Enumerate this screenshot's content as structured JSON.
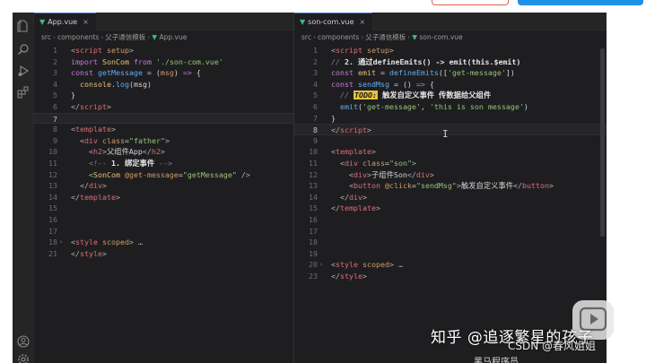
{
  "left_editor": {
    "tab_label": "App.vue",
    "breadcrumb": [
      "src",
      "components",
      "父子通信模板",
      "App.vue"
    ],
    "lines": [
      {
        "n": "1",
        "html": "<span class=\"t-pun\">&lt;</span><span class=\"t-tag\">script</span> <span class=\"t-attr\">setup</span><span class=\"t-pun\">&gt;</span>"
      },
      {
        "n": "2",
        "html": "<span class=\"t-kw\">import</span> <span class=\"t-var\">SonCom</span> <span class=\"t-kw\">from</span> <span class=\"t-str\">'./son-com.vue'</span>"
      },
      {
        "n": "3",
        "html": "<span class=\"t-kw\">const</span> <span class=\"t-fn\">getMessage</span> = (<span class=\"t-attr\">msg</span>) <span class=\"t-kw\">=&gt;</span> {"
      },
      {
        "n": "4",
        "html": "  <span class=\"t-var\">console</span>.<span class=\"t-fn\">log</span>(msg)"
      },
      {
        "n": "5",
        "html": "}"
      },
      {
        "n": "6",
        "html": "<span class=\"t-pun\">&lt;/</span><span class=\"t-tag\">script</span><span class=\"t-pun\">&gt;</span>"
      },
      {
        "n": "7",
        "html": "",
        "current": true
      },
      {
        "n": "8",
        "html": "<span class=\"t-pun\">&lt;</span><span class=\"t-tag\">template</span><span class=\"t-pun\">&gt;</span>"
      },
      {
        "n": "9",
        "html": "  <span class=\"t-pun\">&lt;</span><span class=\"t-tag\">div</span> <span class=\"t-attr\">class</span>=<span class=\"t-str\">\"father\"</span><span class=\"t-pun\">&gt;</span>"
      },
      {
        "n": "10",
        "html": "    <span class=\"t-pun\">&lt;</span><span class=\"t-tag\">h2</span><span class=\"t-pun\">&gt;</span>父组件App<span class=\"t-pun\">&lt;/</span><span class=\"t-tag\">h2</span><span class=\"t-pun\">&gt;</span>"
      },
      {
        "n": "11",
        "html": "    <span class=\"t-cmt\">&lt;!-- <span class=\"t-cmt-b\">1. 绑定事件</span> --&gt;</span>"
      },
      {
        "n": "12",
        "html": "    <span class=\"t-pun\">&lt;</span><span class=\"t-var\">SonCom</span> <span class=\"t-attr\">@get-message</span>=<span class=\"t-str\">\"getMessage\"</span> <span class=\"t-pun\">/&gt;</span>"
      },
      {
        "n": "13",
        "html": "  <span class=\"t-pun\">&lt;/</span><span class=\"t-tag\">div</span><span class=\"t-pun\">&gt;</span>"
      },
      {
        "n": "14",
        "html": "<span class=\"t-pun\">&lt;/</span><span class=\"t-tag\">template</span><span class=\"t-pun\">&gt;</span>"
      },
      {
        "n": "15",
        "html": ""
      },
      {
        "n": "16",
        "html": ""
      },
      {
        "n": "17",
        "html": ""
      },
      {
        "n": "18",
        "html": "<span class=\"t-pun\">&lt;</span><span class=\"t-tag\">style</span> <span class=\"t-attr\">scoped</span><span class=\"t-pun\">&gt;</span> <span class=\"t-pun\">…</span>",
        "fold": true
      },
      {
        "n": "21",
        "html": "<span class=\"t-pun\">&lt;/</span><span class=\"t-tag\">style</span><span class=\"t-pun\">&gt;</span>"
      }
    ]
  },
  "right_editor": {
    "tab_label": "son-com.vue",
    "breadcrumb": [
      "src",
      "components",
      "父子通信模板",
      "son-com.vue"
    ],
    "lines": [
      {
        "n": "1",
        "html": "<span class=\"t-pun\">&lt;</span><span class=\"t-tag\">script</span> <span class=\"t-attr\">setup</span><span class=\"t-pun\">&gt;</span>"
      },
      {
        "n": "2",
        "html": "<span class=\"t-cmt\">// <span class=\"t-cmt-b\">2. 通过defineEmits() -&gt; emit(this.$emit)</span></span>"
      },
      {
        "n": "3",
        "html": "<span class=\"t-kw\">const</span> <span class=\"t-var\">emit</span> = <span class=\"t-fn\">defineEmits</span>([<span class=\"t-str\">'get-message'</span>])"
      },
      {
        "n": "4",
        "html": "<span class=\"t-kw\">const</span> <span class=\"t-fn\">sendMsg</span> = () <span class=\"t-kw\">=&gt;</span> {"
      },
      {
        "n": "5",
        "html": "  <span class=\"t-cmt\">// <span class=\"t-todo\">TODO:</span> <span class=\"t-cmt-b\">触发自定义事件 传数据给父组件</span></span>"
      },
      {
        "n": "6",
        "html": "  <span class=\"t-fn\">emit</span>(<span class=\"t-str\">'get-message'</span>, <span class=\"t-str\">'this is son message'</span>)"
      },
      {
        "n": "7",
        "html": "}"
      },
      {
        "n": "8",
        "html": "<span class=\"t-pun\">&lt;/</span><span class=\"t-tag\">script</span><span class=\"t-pun\">&gt;</span>",
        "current": true
      },
      {
        "n": "9",
        "html": ""
      },
      {
        "n": "10",
        "html": "<span class=\"t-pun\">&lt;</span><span class=\"t-tag\">template</span><span class=\"t-pun\">&gt;</span>"
      },
      {
        "n": "11",
        "html": "  <span class=\"t-pun\">&lt;</span><span class=\"t-tag\">div</span> <span class=\"t-attr\">class</span>=<span class=\"t-str\">\"son\"</span><span class=\"t-pun\">&gt;</span>"
      },
      {
        "n": "12",
        "html": "    <span class=\"t-pun\">&lt;</span><span class=\"t-tag\">div</span><span class=\"t-pun\">&gt;</span>子组件Son<span class=\"t-pun\">&lt;/</span><span class=\"t-tag\">div</span><span class=\"t-pun\">&gt;</span>"
      },
      {
        "n": "13",
        "html": "    <span class=\"t-pun\">&lt;</span><span class=\"t-tag\">button</span> <span class=\"t-attr\">@click</span>=<span class=\"t-str\">\"sendMsg\"</span><span class=\"t-pun\">&gt;</span>触发自定义事件<span class=\"t-pun\">&lt;/</span><span class=\"t-tag\">button</span><span class=\"t-pun\">&gt;</span>"
      },
      {
        "n": "14",
        "html": "  <span class=\"t-pun\">&lt;/</span><span class=\"t-tag\">div</span><span class=\"t-pun\">&gt;</span>"
      },
      {
        "n": "15",
        "html": "<span class=\"t-pun\">&lt;/</span><span class=\"t-tag\">template</span><span class=\"t-pun\">&gt;</span>"
      },
      {
        "n": "16",
        "html": ""
      },
      {
        "n": "17",
        "html": ""
      },
      {
        "n": "18",
        "html": ""
      },
      {
        "n": "19",
        "html": ""
      },
      {
        "n": "20",
        "html": "<span class=\"t-pun\">&lt;</span><span class=\"t-tag\">style</span> <span class=\"t-attr\">scoped</span><span class=\"t-pun\">&gt;</span> <span class=\"t-pun\">…</span>",
        "fold": true
      },
      {
        "n": "23",
        "html": "<span class=\"t-pun\">&lt;/</span><span class=\"t-tag\">style</span><span class=\"t-pun\">&gt;</span>"
      }
    ]
  },
  "watermarks": {
    "zhihu": "知乎 @追逐繁星的孩子",
    "csdn": "CSDN @春风姐姐",
    "bottom": "黑马程序员"
  },
  "icons": {
    "files": "files-icon",
    "search": "search-icon",
    "run_debug": "run-debug-icon",
    "extensions": "extensions-icon",
    "account": "account-icon",
    "settings": "settings-icon"
  },
  "colors": {
    "editor_bg": "#1e1e20",
    "todo_highlight": "#e8c13a",
    "vue_green": "#41b883"
  }
}
